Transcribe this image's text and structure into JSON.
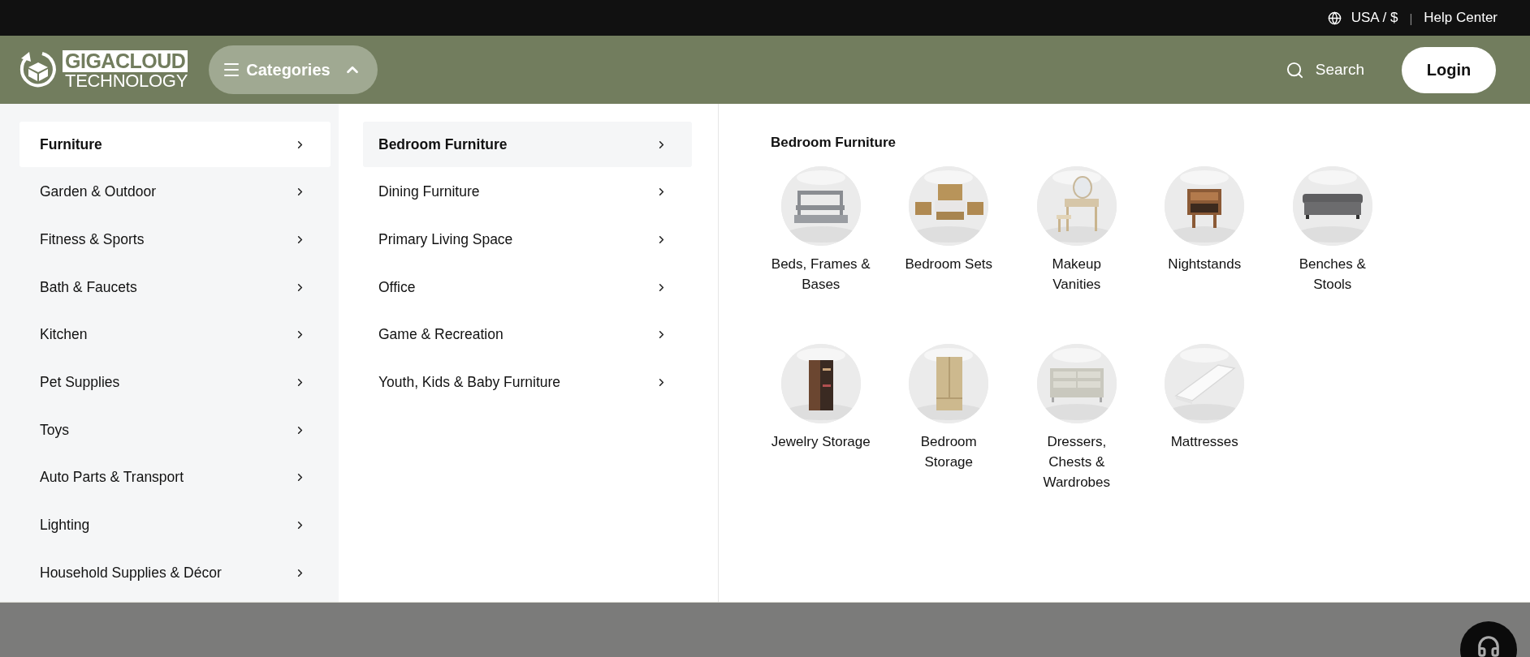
{
  "top_bar": {
    "region": "USA / $",
    "separator": "|",
    "help": "Help Center"
  },
  "header": {
    "logo": {
      "line1": "GIGACLOUD",
      "line2": "TECHNOLOGY"
    },
    "categories_button": {
      "label": "Categories",
      "expanded": true
    },
    "search": {
      "label": "Search"
    },
    "login": {
      "label": "Login"
    }
  },
  "categories": [
    {
      "label": "Furniture",
      "selected": true
    },
    {
      "label": "Garden & Outdoor",
      "selected": false
    },
    {
      "label": "Fitness & Sports",
      "selected": false
    },
    {
      "label": "Bath & Faucets",
      "selected": false
    },
    {
      "label": "Kitchen",
      "selected": false
    },
    {
      "label": "Pet Supplies",
      "selected": false
    },
    {
      "label": "Toys",
      "selected": false
    },
    {
      "label": "Auto Parts & Transport",
      "selected": false
    },
    {
      "label": "Lighting",
      "selected": false
    },
    {
      "label": "Household Supplies & Décor",
      "selected": false
    }
  ],
  "subcategories": [
    {
      "label": "Bedroom Furniture",
      "selected": true
    },
    {
      "label": "Dining Furniture",
      "selected": false
    },
    {
      "label": "Primary Living Space",
      "selected": false
    },
    {
      "label": "Office",
      "selected": false
    },
    {
      "label": "Game & Recreation",
      "selected": false
    },
    {
      "label": "Youth, Kids & Baby Furniture",
      "selected": false
    }
  ],
  "panel": {
    "title": "Bedroom Furniture",
    "items": [
      {
        "label": "Beds, Frames & Bases",
        "kind": "picture"
      },
      {
        "label": "Bedroom Sets",
        "kind": "picture"
      },
      {
        "label": "Makeup Vanities",
        "kind": "picture"
      },
      {
        "label": "Nightstands",
        "kind": "picture"
      },
      {
        "label": "Benches & Stools",
        "kind": "picture"
      },
      {
        "label": "Jewelry Storage",
        "kind": "picture"
      },
      {
        "label": "Bedroom Storage",
        "kind": "picture"
      },
      {
        "label": "Dressers, Chests & Wardrobes",
        "kind": "picture"
      },
      {
        "label": "Mattresses",
        "kind": "picture"
      }
    ]
  }
}
